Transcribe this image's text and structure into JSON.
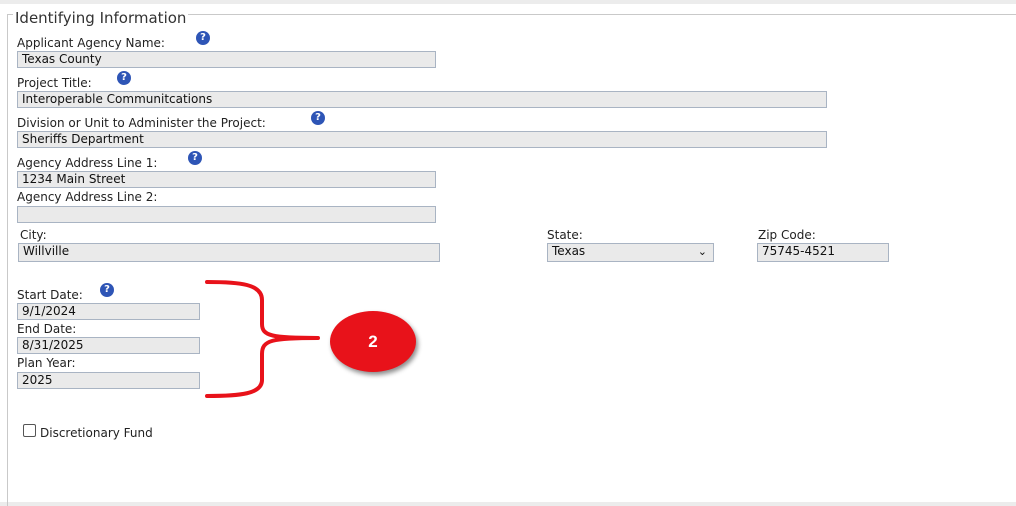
{
  "section_title": "Identifying Information",
  "fields": {
    "applicant_agency_name": {
      "label": "Applicant Agency Name:",
      "value": "Texas County"
    },
    "project_title": {
      "label": "Project Title:",
      "value": "Interoperable Communitcations"
    },
    "division": {
      "label": "Division or Unit to Administer the Project:",
      "value": "Sheriffs Department"
    },
    "address_line1": {
      "label": "Agency Address Line 1:",
      "value": "1234 Main Street"
    },
    "address_line2": {
      "label": "Agency Address Line 2:",
      "value": ""
    },
    "city": {
      "label": "City:",
      "value": "Willville"
    },
    "state": {
      "label": "State:",
      "value": "Texas"
    },
    "zip": {
      "label": "Zip Code:",
      "value": "75745-4521"
    },
    "start_date": {
      "label": "Start Date:",
      "value": "9/1/2024"
    },
    "end_date": {
      "label": "End Date:",
      "value": "8/31/2025"
    },
    "plan_year": {
      "label": "Plan Year:",
      "value": "2025"
    }
  },
  "discretionary_fund": {
    "label": "Discretionary Fund",
    "checked": false
  },
  "annotation": {
    "badge_text": "2",
    "color": "#e8121a"
  },
  "icons": {
    "help": "question-circle-icon",
    "dropdown": "chevron-down-icon"
  },
  "help_glyph": "?",
  "chevron_glyph": "⌄",
  "colors": {
    "help_icon": "#2e55b6",
    "input_bg": "#eaeaea",
    "input_border": "#a9b4c3"
  }
}
